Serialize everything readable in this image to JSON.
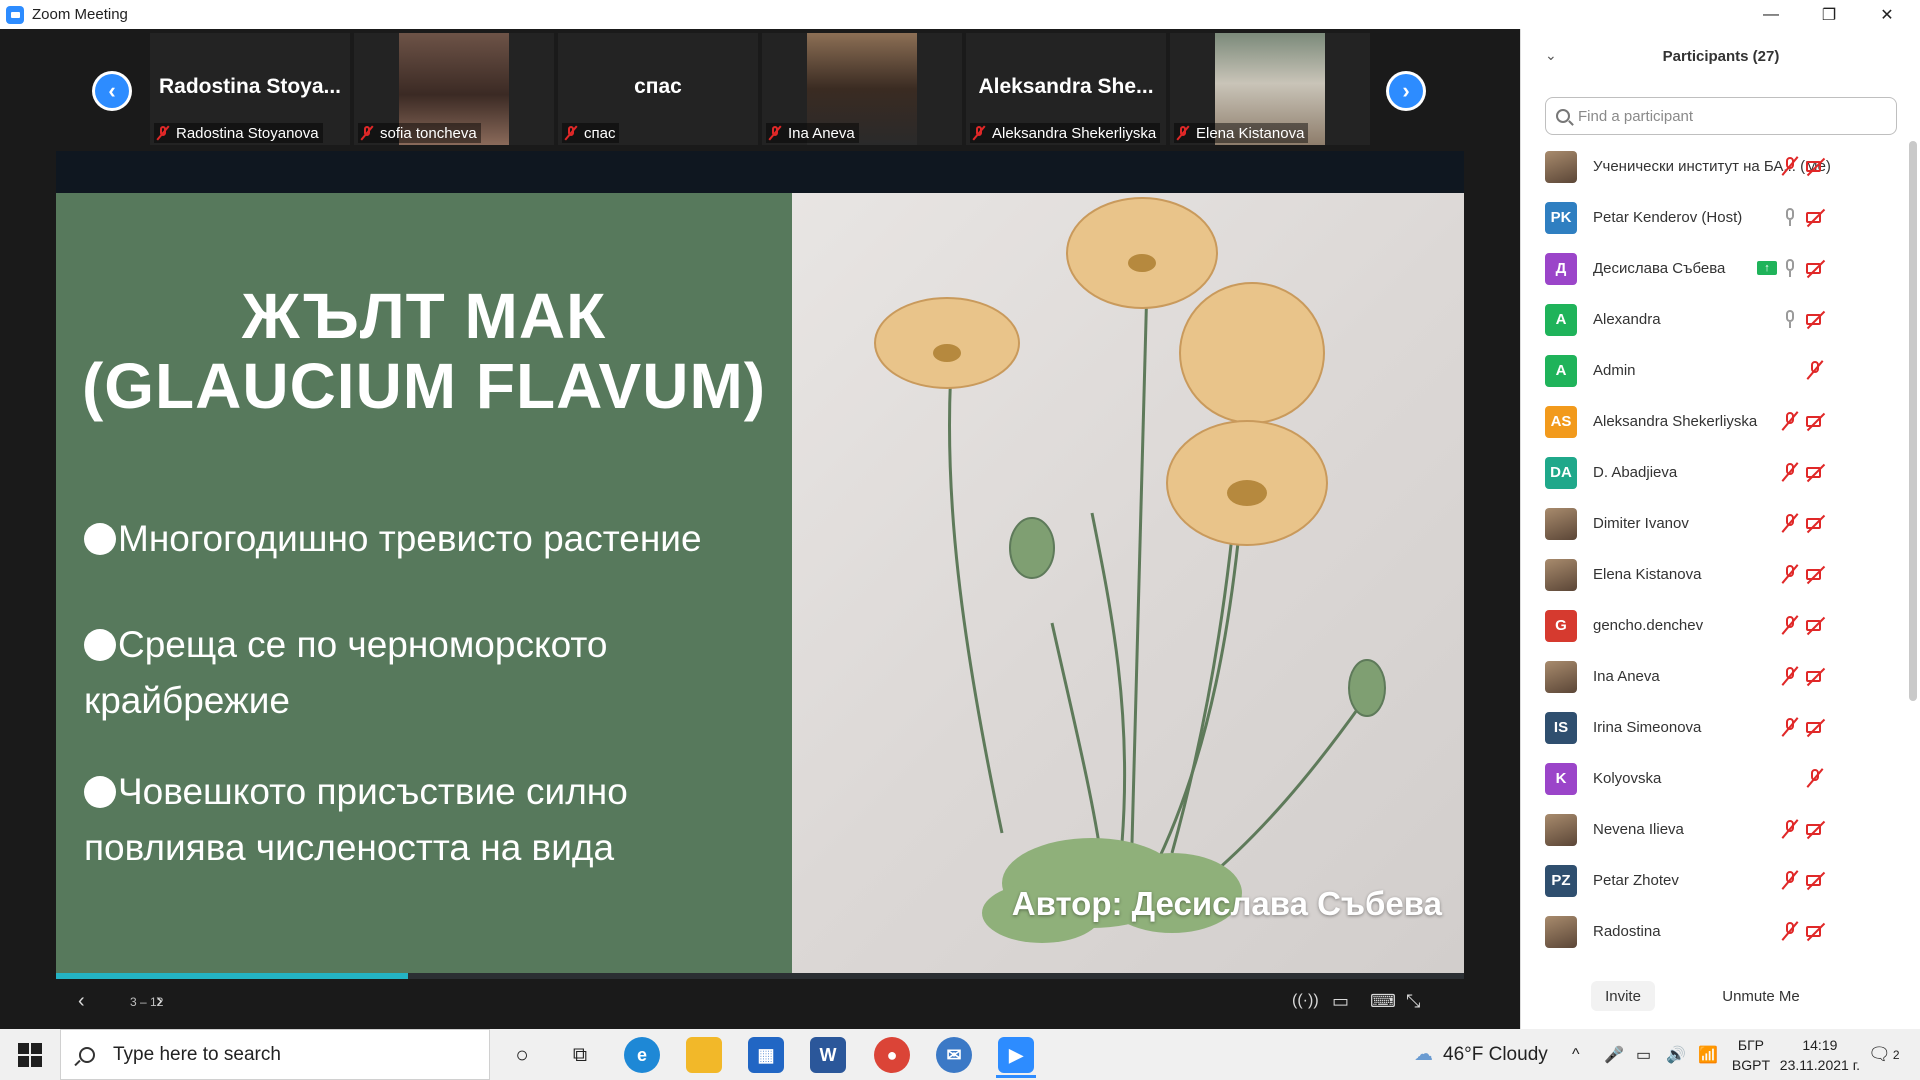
{
  "window": {
    "title": "Zoom Meeting",
    "controls": {
      "minimize": "—",
      "maximize": "❐",
      "close": "✕"
    }
  },
  "gallery": {
    "tiles": [
      {
        "big_name": "Radostina  Stoya...",
        "label": "Radostina Stoyanova",
        "video": false
      },
      {
        "big_name": "",
        "label": "sofia toncheva",
        "video": true
      },
      {
        "big_name": "спас",
        "label": "спас",
        "video": false
      },
      {
        "big_name": "",
        "label": "Ina Aneva",
        "video": true
      },
      {
        "big_name": "Aleksandra  She...",
        "label": "Aleksandra Shekerliyska",
        "video": false
      },
      {
        "big_name": "",
        "label": "Elena Kistanova",
        "video": true
      }
    ],
    "prev_icon": "chevron-left-icon",
    "next_icon": "chevron-right-icon"
  },
  "slide": {
    "title_line1": "ЖЪЛТ МАК",
    "title_line2": "(GLAUCIUM FLAVUM)",
    "bullets": [
      {
        "line1": "Многогодишно тревисто растение",
        "line2": ""
      },
      {
        "line1": "Среща се по  черноморското",
        "line2": "крайбрежие"
      },
      {
        "line1": "Човешкото присъствие силно",
        "line2": "повлиява числеността на вида"
      }
    ],
    "author": "Автор: Десислава Събева",
    "page_indicator": "3 – 12",
    "progress": 0.25,
    "colors": {
      "left_bg": "#57795c",
      "progress": "#24b3c4"
    }
  },
  "participants": {
    "title": "Participants (27)",
    "search_placeholder": "Find a participant",
    "items": [
      {
        "name": "Ученически институт на БА... (Me)",
        "avatar": "",
        "avatar_color": "",
        "photo": true,
        "mic": "off",
        "video": "off",
        "sharing": false
      },
      {
        "name": "Petar Kenderov (Host)",
        "avatar": "PK",
        "avatar_color": "#2f7fc1",
        "photo": false,
        "mic": "on",
        "video": "off",
        "sharing": false
      },
      {
        "name": "Десислава Събева",
        "avatar": "Д",
        "avatar_color": "#9b45c9",
        "photo": false,
        "mic": "on",
        "video": "off",
        "sharing": true
      },
      {
        "name": "Alexandra",
        "avatar": "A",
        "avatar_color": "#1fb35a",
        "photo": false,
        "mic": "on",
        "video": "off",
        "sharing": false
      },
      {
        "name": "Admin",
        "avatar": "A",
        "avatar_color": "#1fb35a",
        "photo": false,
        "mic": "off",
        "video": "none",
        "sharing": false
      },
      {
        "name": "Aleksandra Shekerliyska",
        "avatar": "AS",
        "avatar_color": "#f29a1c",
        "photo": false,
        "mic": "off",
        "video": "off",
        "sharing": false
      },
      {
        "name": "D. Abadjieva",
        "avatar": "DA",
        "avatar_color": "#1fa88a",
        "photo": false,
        "mic": "off",
        "video": "off",
        "sharing": false
      },
      {
        "name": "Dimiter Ivanov",
        "avatar": "",
        "avatar_color": "",
        "photo": true,
        "mic": "off",
        "video": "off",
        "sharing": false
      },
      {
        "name": "Elena Kistanova",
        "avatar": "",
        "avatar_color": "",
        "photo": true,
        "mic": "off",
        "video": "off",
        "sharing": false
      },
      {
        "name": "gencho.denchev",
        "avatar": "G",
        "avatar_color": "#d63a2f",
        "photo": false,
        "mic": "off",
        "video": "off",
        "sharing": false
      },
      {
        "name": "Ina Aneva",
        "avatar": "",
        "avatar_color": "",
        "photo": true,
        "mic": "off",
        "video": "off",
        "sharing": false
      },
      {
        "name": "Irina Simeonova",
        "avatar": "IS",
        "avatar_color": "#2f4f6f",
        "photo": false,
        "mic": "off",
        "video": "off",
        "sharing": false
      },
      {
        "name": "Kolyovska",
        "avatar": "K",
        "avatar_color": "#9b45c9",
        "photo": false,
        "mic": "off",
        "video": "none",
        "sharing": false
      },
      {
        "name": "Nevena Ilieva",
        "avatar": "",
        "avatar_color": "",
        "photo": true,
        "mic": "off",
        "video": "off",
        "sharing": false
      },
      {
        "name": "Petar Zhotev",
        "avatar": "PZ",
        "avatar_color": "#2f4f6f",
        "photo": false,
        "mic": "off",
        "video": "off",
        "sharing": false
      },
      {
        "name": "Radostina",
        "avatar": "",
        "avatar_color": "",
        "photo": true,
        "mic": "off",
        "video": "off",
        "sharing": false
      }
    ],
    "invite_label": "Invite",
    "unmute_label": "Unmute Me"
  },
  "taskbar": {
    "search_placeholder": "Type here to search",
    "weather": "46°F  Cloudy",
    "lang_line1": "БГР",
    "lang_line2": "BGPT",
    "time": "14:19",
    "date": "23.11.2021 г.",
    "notifications": "2",
    "apps": [
      "task-view-icon",
      "edge-icon",
      "file-explorer-icon",
      "store-icon",
      "word-icon",
      "chrome-icon",
      "thunderbird-icon",
      "zoom-icon"
    ]
  }
}
